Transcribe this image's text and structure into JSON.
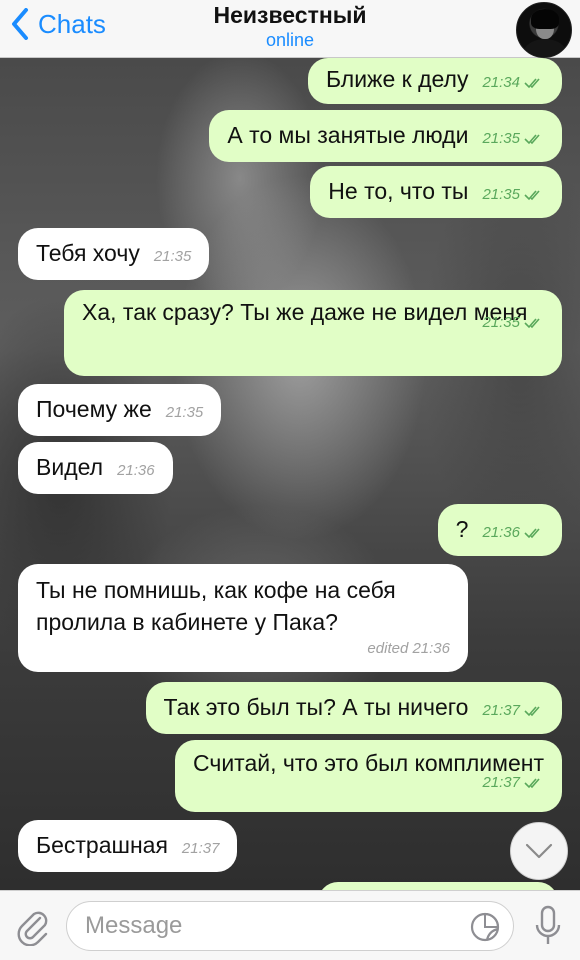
{
  "header": {
    "back_label": "Chats",
    "title": "Неизвестный",
    "status": "online"
  },
  "messages": [
    {
      "dir": "out",
      "text": "Ближе к делу",
      "time": "21:34",
      "read": true
    },
    {
      "dir": "out",
      "text": "А то мы занятые люди",
      "time": "21:35",
      "read": true
    },
    {
      "dir": "out",
      "text": "Не то, что ты",
      "time": "21:35",
      "read": true
    },
    {
      "dir": "in",
      "text": "Тебя хочу",
      "time": "21:35"
    },
    {
      "dir": "out",
      "text": "Ха, так сразу? Ты же даже не видел меня",
      "time": "21:35",
      "read": true
    },
    {
      "dir": "in",
      "text": "Почему же",
      "time": "21:35"
    },
    {
      "dir": "in",
      "text": "Видел",
      "time": "21:36"
    },
    {
      "dir": "out",
      "text": "?",
      "time": "21:36",
      "read": true
    },
    {
      "dir": "in",
      "text": "Ты не помнишь, как кофе на себя пролила в кабинете у Пака?",
      "time": "edited 21:36"
    },
    {
      "dir": "out",
      "text": "Так это был ты? А ты ничего",
      "time": "21:37",
      "read": true
    },
    {
      "dir": "out",
      "text": "Считай, что это был комплимент",
      "time": "21:37",
      "read": true
    },
    {
      "dir": "in",
      "text": "Бестрашная",
      "time": "21:37"
    }
  ],
  "input": {
    "placeholder": "Message"
  },
  "colors": {
    "accent": "#1a8cff",
    "outgoing_bubble": "#e1fec6",
    "incoming_bubble": "#ffffff",
    "outgoing_time": "#5aa85c"
  },
  "icons": {
    "back": "chevron-left-icon",
    "read": "double-check-icon",
    "scroll": "chevron-down-icon",
    "attach": "paperclip-icon",
    "sticker": "sticker-icon",
    "mic": "microphone-icon"
  }
}
